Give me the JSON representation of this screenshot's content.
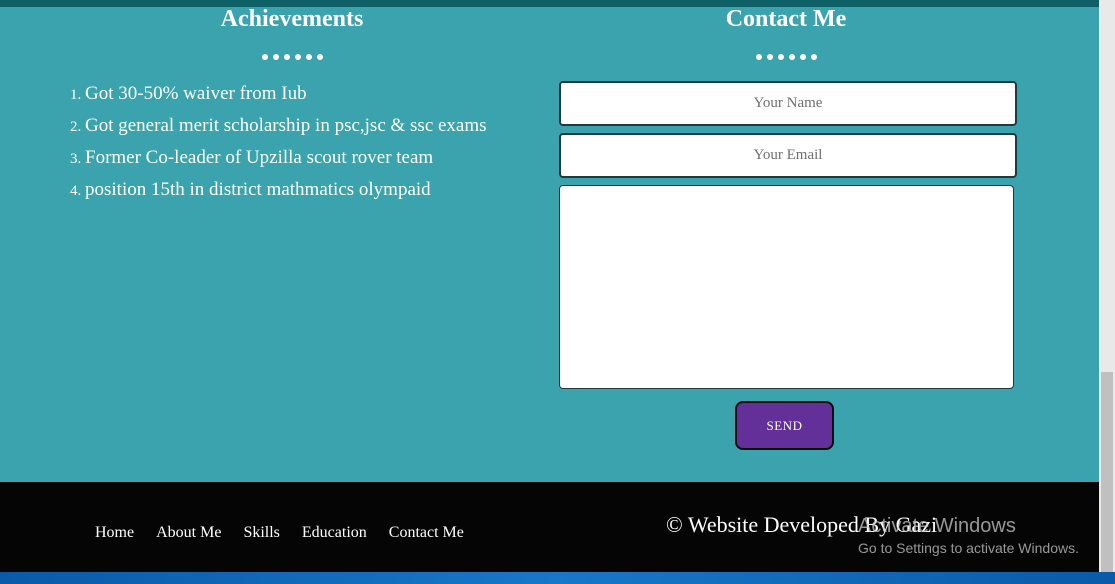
{
  "achievements": {
    "title": "Achievements",
    "items": [
      "Got 30-50% waiver from Iub",
      "Got general merit scholarship in psc,jsc & ssc exams",
      "Former Co-leader of Upzilla scout rover team",
      "position 15th in district mathmatics olympaid"
    ]
  },
  "contact": {
    "title": "Contact Me",
    "name_placeholder": "Your Name",
    "email_placeholder": "Your Email",
    "message_placeholder": "",
    "send_label": "SEND"
  },
  "footer": {
    "nav": [
      "Home",
      "About Me",
      "Skills",
      "Education",
      "Contact Me"
    ],
    "credit": "© Website Developed By Gazi"
  },
  "watermark": {
    "line1": "Activate Windows",
    "line2": "Go to Settings to activate Windows."
  },
  "colors": {
    "background": "#3aa3ad",
    "button": "#63309a",
    "footer": "#050505"
  }
}
